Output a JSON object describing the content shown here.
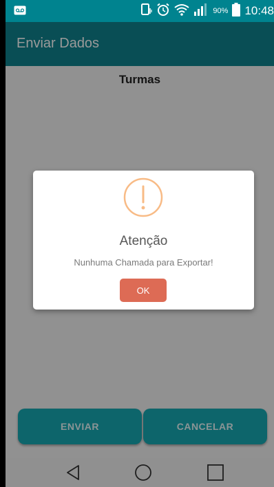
{
  "status_bar": {
    "battery": "90%",
    "time": "10:48",
    "icons": [
      "voicemail-icon",
      "vibrate-icon",
      "alarm-icon",
      "wifi-icon",
      "signal-icon",
      "battery-icon"
    ]
  },
  "app_bar": {
    "title": "Enviar Dados"
  },
  "main": {
    "section_title": "Turmas",
    "buttons": {
      "send": "ENVIAR",
      "cancel": "CANCELAR"
    }
  },
  "dialog": {
    "icon": "warning-icon",
    "title": "Atenção",
    "message": "Nunhuma Chamada para Exportar!",
    "ok_label": "OK",
    "accent": "#f8bb86",
    "button_color": "#dd6b55"
  },
  "nav_bar": {
    "icons": [
      "back-icon",
      "home-icon",
      "recents-icon"
    ]
  },
  "colors": {
    "primary": "#10828e",
    "button": "#17a8b3"
  }
}
